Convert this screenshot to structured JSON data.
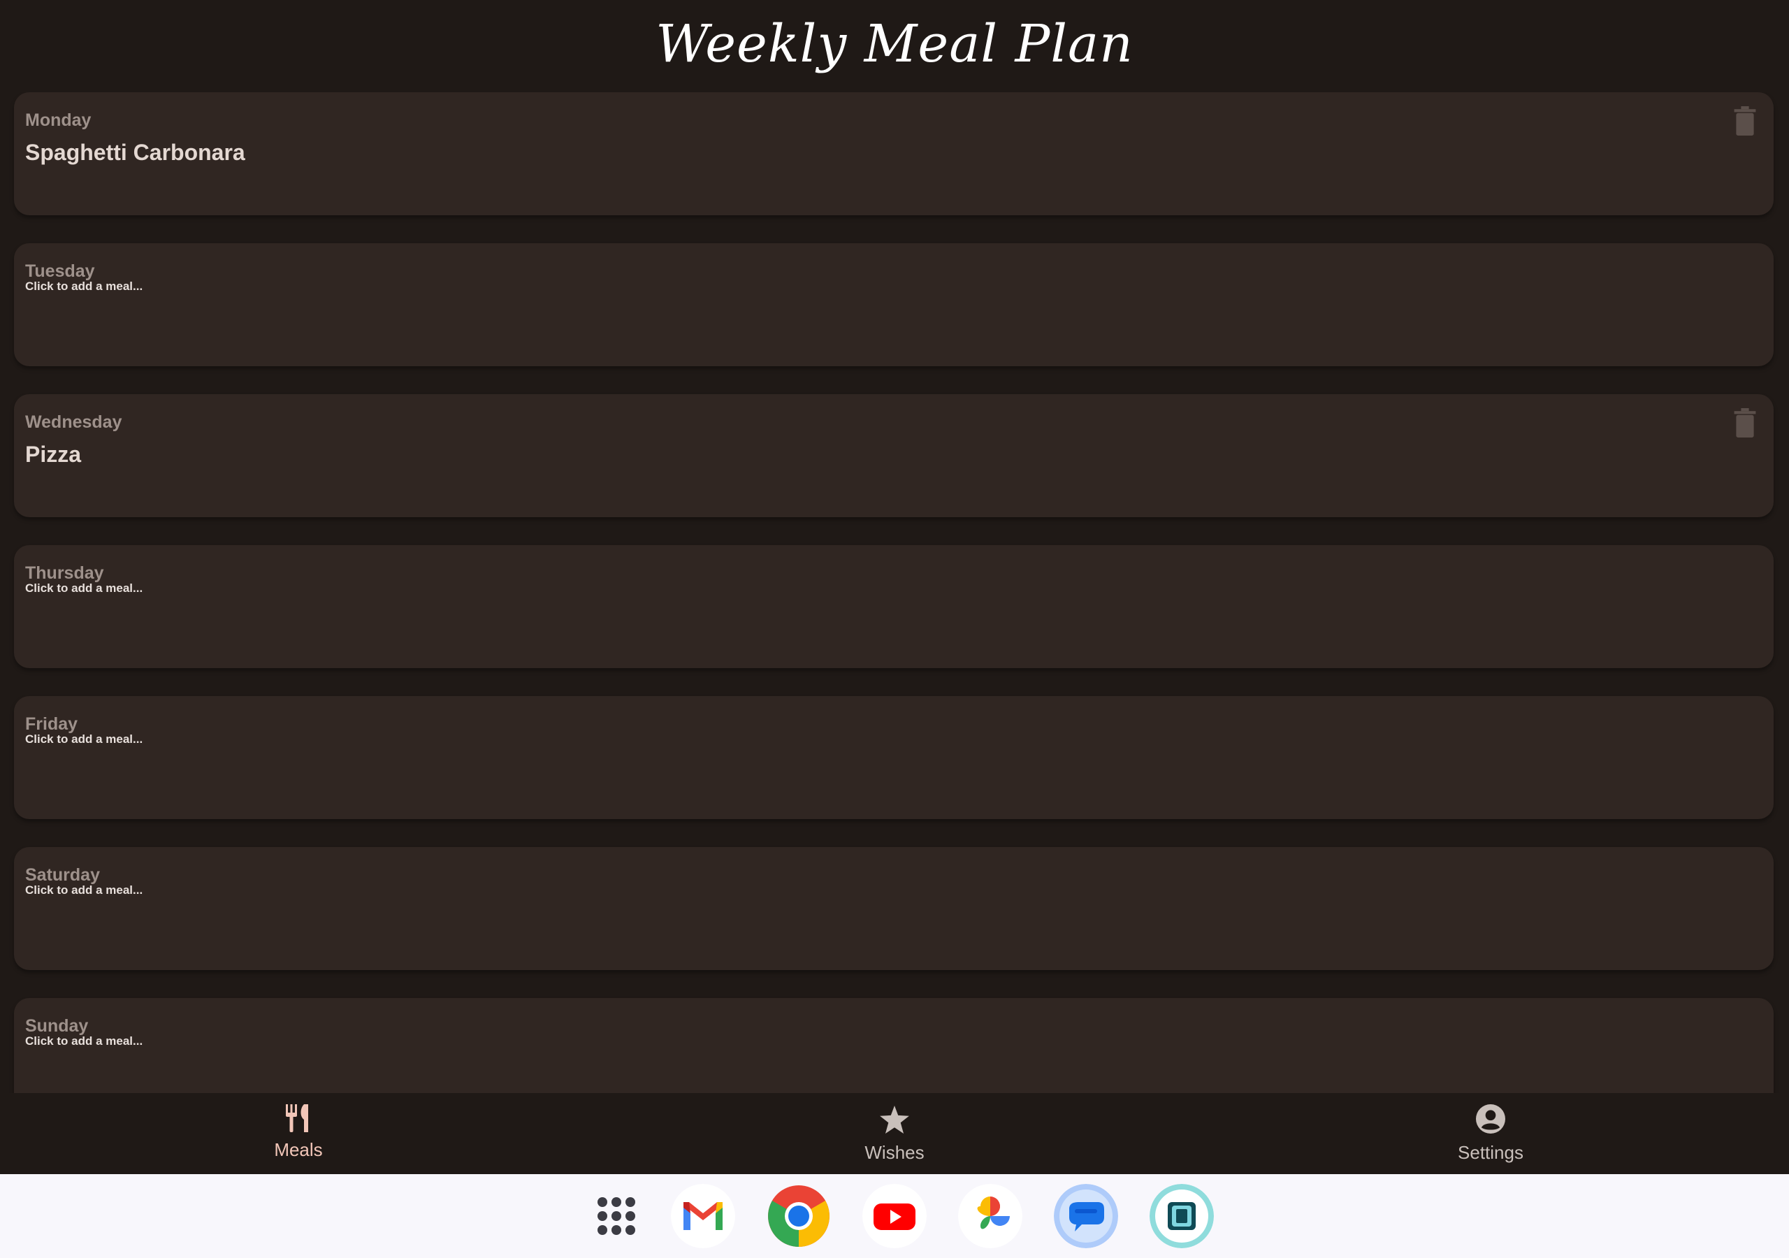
{
  "app": {
    "title": "Weekly Meal Plan"
  },
  "days": [
    {
      "day": "Monday",
      "meal": "Spaghetti Carbonara",
      "placeholder": "",
      "has_meal": true
    },
    {
      "day": "Tuesday",
      "meal": "",
      "placeholder": "Click to add a meal...",
      "has_meal": false
    },
    {
      "day": "Wednesday",
      "meal": "Pizza",
      "placeholder": "",
      "has_meal": true
    },
    {
      "day": "Thursday",
      "meal": "",
      "placeholder": "Click to add a meal...",
      "has_meal": false
    },
    {
      "day": "Friday",
      "meal": "",
      "placeholder": "Click to add a meal...",
      "has_meal": false
    },
    {
      "day": "Saturday",
      "meal": "",
      "placeholder": "Click to add a meal...",
      "has_meal": false
    },
    {
      "day": "Sunday",
      "meal": "",
      "placeholder": "Click to add a meal...",
      "has_meal": false
    }
  ],
  "nav": {
    "items": [
      {
        "label": "Meals",
        "icon": "fork-knife-icon",
        "active": true
      },
      {
        "label": "Wishes",
        "icon": "star-icon",
        "active": false
      },
      {
        "label": "Settings",
        "icon": "account-circle-icon",
        "active": false
      }
    ]
  },
  "taskbar": {
    "apps": [
      "app-drawer-icon",
      "gmail-icon",
      "chrome-icon",
      "youtube-icon",
      "photos-icon",
      "messages-icon",
      "app-icon"
    ]
  },
  "colors": {
    "background": "#1f1916",
    "card": "#302622",
    "accent": "#f2c6b8",
    "inactive": "#c9c0bb",
    "taskbar": "#f8f7fc"
  }
}
